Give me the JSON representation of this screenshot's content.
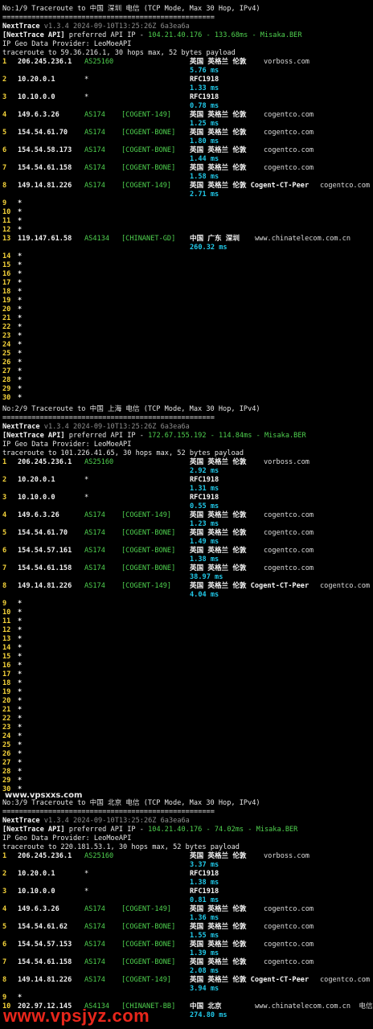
{
  "sections": [
    {
      "title": "No:1/9 Traceroute to 中国 深圳 电信 (TCP Mode, Max 30 Hop, IPv4)",
      "sep": "===================================================",
      "version_name": "NextTrace",
      "version_info": "v1.3.4 2024-09-10T13:25:26Z 6a3ea6a",
      "api_prefix": "[NextTrace API]",
      "api_mid": " preferred API IP - ",
      "api_ip": "104.21.40.176 - 133.68ms - Misaka.BER",
      "geo_provider": "IP Geo Data Provider: LeoMoeAPI",
      "trace_line": "traceroute to 59.36.216.1, 30 hops max, 52 bytes payload",
      "hops": [
        {
          "n": "1",
          "ip": "206.245.236.1",
          "as": "AS25160",
          "tag": "",
          "geo": "英国 英格兰 伦敦",
          "host": "vorboss.com",
          "ms": "5.76 ms"
        },
        {
          "n": "2",
          "ip": "10.20.0.1",
          "as": "*",
          "tag": "",
          "geo": "RFC1918",
          "host": "",
          "ms": "1.33 ms"
        },
        {
          "n": "3",
          "ip": "10.10.0.0",
          "as": "*",
          "tag": "",
          "geo": "RFC1918",
          "host": "",
          "ms": "0.78 ms"
        },
        {
          "n": "4",
          "ip": "149.6.3.26",
          "as": "AS174",
          "tag": "[COGENT-149]",
          "geo": "英国 英格兰 伦敦",
          "host": "cogentco.com",
          "ms": "1.25 ms"
        },
        {
          "n": "5",
          "ip": "154.54.61.70",
          "as": "AS174",
          "tag": "[COGENT-BONE]",
          "geo": "英国 英格兰 伦敦",
          "host": "cogentco.com",
          "ms": "1.80 ms"
        },
        {
          "n": "6",
          "ip": "154.54.58.173",
          "as": "AS174",
          "tag": "[COGENT-BONE]",
          "geo": "英国 英格兰 伦敦",
          "host": "cogentco.com",
          "ms": "1.44 ms"
        },
        {
          "n": "7",
          "ip": "154.54.61.158",
          "as": "AS174",
          "tag": "[COGENT-BONE]",
          "geo": "英国 英格兰 伦敦",
          "host": "cogentco.com",
          "ms": "1.58 ms"
        },
        {
          "n": "8",
          "ip": "149.14.81.226",
          "as": "AS174",
          "tag": "[COGENT-149]",
          "geo": "英国 英格兰 伦敦 Cogent-CT-Peer",
          "host": "cogentco.com",
          "ms": "2.71 ms"
        }
      ],
      "stars_a": [
        "9",
        "10",
        "11",
        "12"
      ],
      "hop_mid": {
        "n": "13",
        "ip": "119.147.61.58",
        "as": "AS4134",
        "tag": "[CHINANET-GD]",
        "geo": "中国 广东 深圳",
        "host": "www.chinatelecom.com.cn",
        "ms": "260.32 ms"
      },
      "stars_b": [
        "14",
        "15",
        "16",
        "17",
        "18",
        "19",
        "20",
        "21",
        "22",
        "23",
        "24",
        "25",
        "26",
        "27",
        "28",
        "29",
        "30"
      ]
    },
    {
      "title": "No:2/9 Traceroute to 中国 上海 电信 (TCP Mode, Max 30 Hop, IPv4)",
      "sep": "===================================================",
      "version_name": "NextTrace",
      "version_info": "v1.3.4 2024-09-10T13:25:26Z 6a3ea6a",
      "api_prefix": "[NextTrace API]",
      "api_mid": " preferred API IP - ",
      "api_ip": "172.67.155.192 - 114.84ms - Misaka.BER",
      "geo_provider": "IP Geo Data Provider: LeoMoeAPI",
      "trace_line": "traceroute to 101.226.41.65, 30 hops max, 52 bytes payload",
      "hops": [
        {
          "n": "1",
          "ip": "206.245.236.1",
          "as": "AS25160",
          "tag": "",
          "geo": "英国 英格兰 伦敦",
          "host": "vorboss.com",
          "ms": "2.92 ms"
        },
        {
          "n": "2",
          "ip": "10.20.0.1",
          "as": "*",
          "tag": "",
          "geo": "RFC1918",
          "host": "",
          "ms": "1.31 ms"
        },
        {
          "n": "3",
          "ip": "10.10.0.0",
          "as": "*",
          "tag": "",
          "geo": "RFC1918",
          "host": "",
          "ms": "0.55 ms"
        },
        {
          "n": "4",
          "ip": "149.6.3.26",
          "as": "AS174",
          "tag": "[COGENT-149]",
          "geo": "英国 英格兰 伦敦",
          "host": "cogentco.com",
          "ms": "1.23 ms"
        },
        {
          "n": "5",
          "ip": "154.54.61.70",
          "as": "AS174",
          "tag": "[COGENT-BONE]",
          "geo": "英国 英格兰 伦敦",
          "host": "cogentco.com",
          "ms": "1.49 ms"
        },
        {
          "n": "6",
          "ip": "154.54.57.161",
          "as": "AS174",
          "tag": "[COGENT-BONE]",
          "geo": "英国 英格兰 伦敦",
          "host": "cogentco.com",
          "ms": "1.38 ms"
        },
        {
          "n": "7",
          "ip": "154.54.61.158",
          "as": "AS174",
          "tag": "[COGENT-BONE]",
          "geo": "英国 英格兰 伦敦",
          "host": "cogentco.com",
          "ms": "38.97 ms"
        },
        {
          "n": "8",
          "ip": "149.14.81.226",
          "as": "AS174",
          "tag": "[COGENT-149]",
          "geo": "英国 英格兰 伦敦 Cogent-CT-Peer",
          "host": "cogentco.com",
          "ms": "4.04 ms"
        }
      ],
      "stars_a": [
        "9",
        "10",
        "11",
        "12",
        "13",
        "14",
        "15",
        "16",
        "17",
        "18",
        "19",
        "20",
        "21",
        "22",
        "23",
        "24",
        "25",
        "26",
        "27",
        "28",
        "29",
        "30"
      ],
      "hop_mid": null,
      "stars_b": []
    },
    {
      "title": "No:3/9 Traceroute to 中国 北京 电信 (TCP Mode, Max 30 Hop, IPv4)",
      "sep": "===================================================",
      "version_name": "NextTrace",
      "version_info": "v1.3.4 2024-09-10T13:25:26Z 6a3ea6a",
      "api_prefix": "[NextTrace API]",
      "api_mid": " preferred API IP - ",
      "api_ip": "104.21.40.176 - 74.02ms - Misaka.BER",
      "geo_provider": "IP Geo Data Provider: LeoMoeAPI",
      "trace_line": "traceroute to 220.181.53.1, 30 hops max, 52 bytes payload",
      "hops": [
        {
          "n": "1",
          "ip": "206.245.236.1",
          "as": "AS25160",
          "tag": "",
          "geo": "英国 英格兰 伦敦",
          "host": "vorboss.com",
          "ms": "3.37 ms"
        },
        {
          "n": "2",
          "ip": "10.20.0.1",
          "as": "*",
          "tag": "",
          "geo": "RFC1918",
          "host": "",
          "ms": "1.38 ms"
        },
        {
          "n": "3",
          "ip": "10.10.0.0",
          "as": "*",
          "tag": "",
          "geo": "RFC1918",
          "host": "",
          "ms": "0.81 ms"
        },
        {
          "n": "4",
          "ip": "149.6.3.26",
          "as": "AS174",
          "tag": "[COGENT-149]",
          "geo": "英国 英格兰 伦敦",
          "host": "cogentco.com",
          "ms": "1.36 ms"
        },
        {
          "n": "5",
          "ip": "154.54.61.62",
          "as": "AS174",
          "tag": "[COGENT-BONE]",
          "geo": "英国 英格兰 伦敦",
          "host": "cogentco.com",
          "ms": "1.55 ms"
        },
        {
          "n": "6",
          "ip": "154.54.57.153",
          "as": "AS174",
          "tag": "[COGENT-BONE]",
          "geo": "英国 英格兰 伦敦",
          "host": "cogentco.com",
          "ms": "1.39 ms"
        },
        {
          "n": "7",
          "ip": "154.54.61.158",
          "as": "AS174",
          "tag": "[COGENT-BONE]",
          "geo": "英国 英格兰 伦敦",
          "host": "cogentco.com",
          "ms": "2.08 ms"
        },
        {
          "n": "8",
          "ip": "149.14.81.226",
          "as": "AS174",
          "tag": "[COGENT-149]",
          "geo": "英国 英格兰 伦敦 Cogent-CT-Peer",
          "host": "cogentco.com",
          "ms": "3.94 ms"
        }
      ],
      "stars_a": [
        "9"
      ],
      "hop_mid": {
        "n": "10",
        "ip": "202.97.12.145",
        "as": "AS4134",
        "tag": "[CHINANET-BB]",
        "geo": "中国 北京",
        "host": "www.chinatelecom.com.cn  电信",
        "ms": "274.80 ms"
      },
      "stars_b": []
    }
  ],
  "watermark_top": "www.vpsxxs.com",
  "watermark_bottom": "www.vpsjyz.com",
  "colors": {
    "background": "#000000",
    "hop_index": "#f5d33a",
    "asn": "#4fd14f",
    "latency": "#21c8e8",
    "text": "#e6e6e6"
  }
}
